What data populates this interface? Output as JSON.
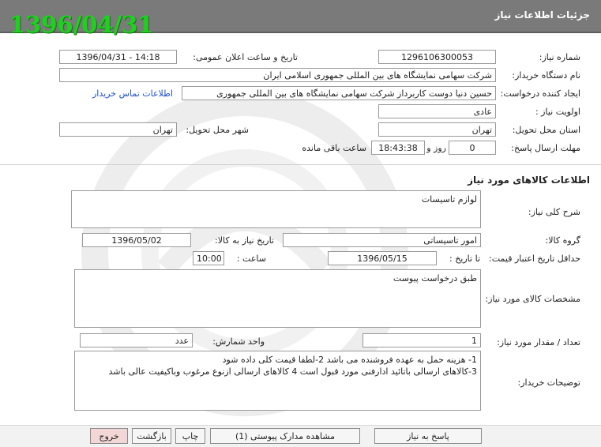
{
  "header": {
    "title": "جزئیات اطلاعات نیاز",
    "date_stamp": "1396/04/31"
  },
  "fields": {
    "need_number": {
      "label": "شماره نیاز:",
      "value": "1296106300053"
    },
    "announce": {
      "label": "تاریخ و ساعت اعلان عمومی:",
      "value": "1396/04/31 - 14:18"
    },
    "buyer_org": {
      "label": "نام دستگاه خریدار:",
      "value": "شرکت سهامی نمایشگاه های بین المللی جمهوری اسلامی ایران"
    },
    "creator": {
      "label": "ایجاد کننده درخواست:",
      "value": "حسین دنیا دوست کاربرداز شرکت سهامی نمایشگاه های بین المللی جمهوری",
      "contact_link": "اطلاعات تماس خریدار"
    },
    "priority": {
      "label": "اولویت نیاز :",
      "value": "عادی"
    },
    "province": {
      "label": "استان محل تحویل:",
      "value": "تهران"
    },
    "city": {
      "label": "شهر محل تحویل:",
      "value": "تهران"
    },
    "deadline": {
      "label": "مهلت ارسال پاسخ:",
      "days": "0",
      "days_label": "روز و",
      "time": "18:43:38",
      "remaining_label": "ساعت باقی مانده"
    }
  },
  "goods_section": {
    "title": "اطلاعات کالاهای مورد نیاز"
  },
  "goods": {
    "general_desc": {
      "label": "شرح کلی نیاز:",
      "value": "لوازم تاسیسات"
    },
    "group": {
      "label": "گروه کالا:",
      "value": "امور تاسیساتی"
    },
    "need_date": {
      "label": "تاریخ نیاز به کالا:",
      "value": "1396/05/02"
    },
    "validity": {
      "label": "حداقل تاریخ اعتبار قیمت:",
      "to_date_label": "تا تاریخ :",
      "date": "1396/05/15",
      "time_label": "ساعت :",
      "time": "10:00"
    },
    "specs": {
      "label": "مشخصات کالای مورد نیاز:",
      "value": "طبق درخواست پیوست"
    },
    "quantity": {
      "label": "تعداد / مقدار مورد نیاز:",
      "value": "1",
      "unit_label": "واحد شمارش:",
      "unit": "عدد"
    },
    "buyer_notes": {
      "label": "توضیحات خریدار:",
      "value": "1- هزینه حمل به عهده فروشنده می باشد 2-لطفا قیمت کلی داده شود\n3-کالاهای ارسالی باتائید ادارفنی مورد قبول است 4 کالاهای ارسالی ازنوع مرغوب وباکیفیت عالی باشد"
    }
  },
  "buttons": {
    "reply": "پاسخ به نیاز",
    "attachments": "مشاهده مدارک پیوستی (1)",
    "print": "چاپ",
    "back": "بازگشت",
    "exit": "خروج"
  },
  "colors": {
    "header_bg": "#7a7a7a",
    "date_stamp": "#1fd11f",
    "link": "#1a4fd6",
    "exit_button": "#f3d7d7"
  }
}
